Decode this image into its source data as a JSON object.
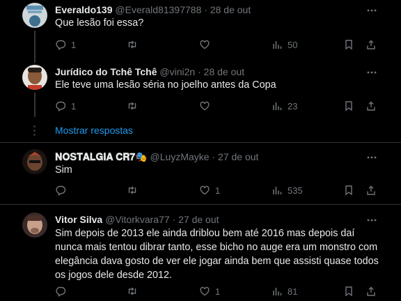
{
  "replies": [
    {
      "name": "Everaldo139",
      "handle": "@Everald81397788",
      "sep": "·",
      "date": "28 de out",
      "text": "Que lesão foi essa?",
      "reply_count": "1",
      "retweet_count": "",
      "like_count": "",
      "view_count": "50"
    },
    {
      "name": "Jurídico do Tchê Tchê",
      "handle": "@vini2n",
      "sep": "·",
      "date": "28 de out",
      "text": "Ele teve uma lesão séria no joelho antes da Copa",
      "reply_count": "1",
      "retweet_count": "",
      "like_count": "",
      "view_count": "23"
    },
    {
      "name": "𝐍𝐎𝐒𝐓𝐀𝐋𝐆𝐈𝐀 𝐂𝐑𝟕🎭",
      "handle": "@LuyzMayke",
      "sep": "·",
      "date": "27 de out",
      "text": "Sim",
      "reply_count": "",
      "retweet_count": "",
      "like_count": "1",
      "view_count": "535"
    },
    {
      "name": "Vitor Silva",
      "handle": "@Vitorkvara77",
      "sep": "·",
      "date": "27 de out",
      "text": "Sim depois de 2013 ele ainda driblou bem até 2016 mas depois daí nunca mais tentou dibrar tanto, esse bicho no auge era um monstro com elegância dava gosto de ver ele jogar ainda bem que assisti quase todos os jogos dele desde 2012.",
      "reply_count": "",
      "retweet_count": "",
      "like_count": "1",
      "view_count": "81"
    }
  ],
  "show_replies_label": "Mostrar respostas",
  "colors": {
    "background": "#000000",
    "text": "#e7e9ea",
    "muted": "#71767b",
    "link": "#1d9bf0",
    "border": "#2f3336"
  }
}
